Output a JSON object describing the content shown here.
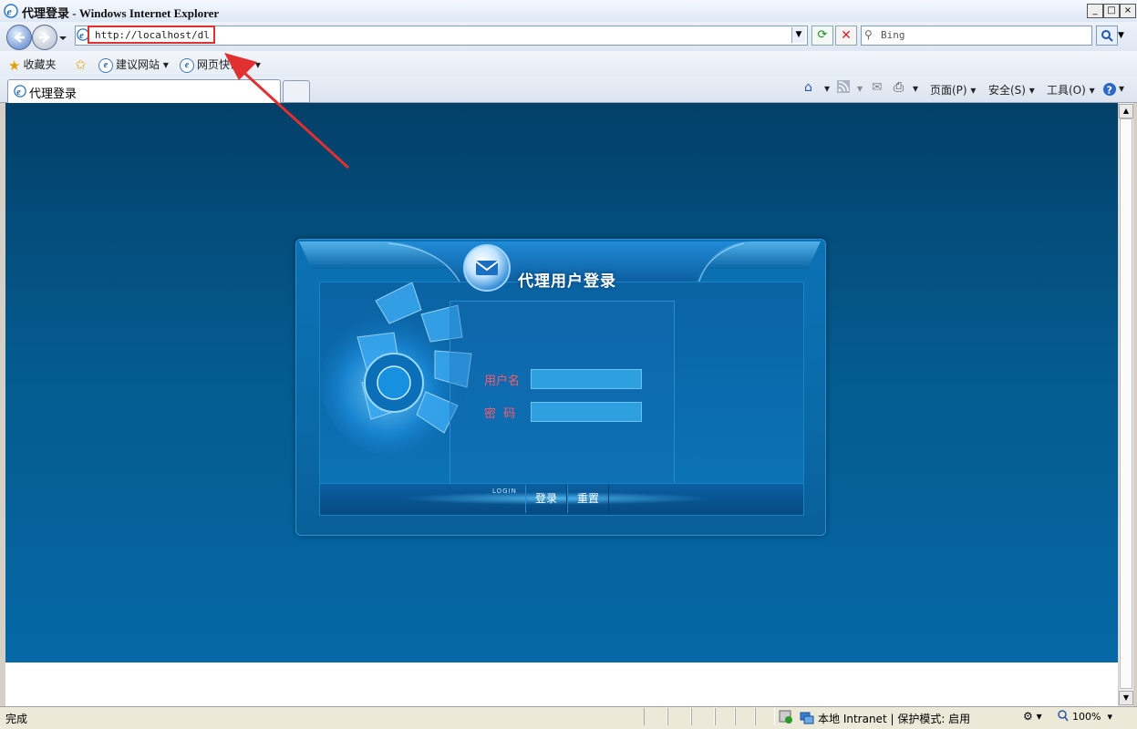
{
  "window": {
    "title": "代理登录 - Windows Internet Explorer",
    "minimize": "_",
    "restore": "□",
    "close": "×"
  },
  "address": {
    "url": "http://localhost/dl",
    "search_placeholder": "Bing"
  },
  "favorites": {
    "label": "收藏夹",
    "items": [
      {
        "label": "建议网站"
      },
      {
        "label": "网页快讯库"
      }
    ]
  },
  "tabs": [
    {
      "label": "代理登录",
      "active": true
    }
  ],
  "commandbar": {
    "page": "页面(P)",
    "safety": "安全(S)",
    "tools": "工具(O)"
  },
  "login": {
    "title": "代理用户登录",
    "username_label": "用户名",
    "password_label": "密  码",
    "username_value": "",
    "password_value": "",
    "tag": "LOGIN",
    "login_button": "登录",
    "reset_button": "重置"
  },
  "status": {
    "text": "完成",
    "zone": "本地 Intranet | 保护模式: 启用",
    "zoom": "100%"
  },
  "colors": {
    "page_background": "#045a8e",
    "field_label": "#ff5a6a",
    "annotation": "#e03030"
  }
}
